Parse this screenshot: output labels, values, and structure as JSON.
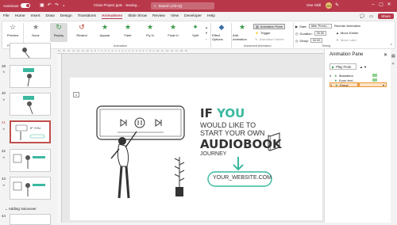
{
  "titlebar": {
    "autosave": "AutoSave",
    "file_title": "Class Project.pptx · Saving...",
    "search_placeholder": "Search (Alt+Q)",
    "user": "One Skill",
    "avatar_initials": "OS"
  },
  "tabs": [
    "File",
    "Home",
    "Insert",
    "Draw",
    "Design",
    "Transitions",
    "Animations",
    "Slide Show",
    "Review",
    "View",
    "Developer",
    "Help"
  ],
  "active_tab": "Animations",
  "share_label": "Share",
  "ribbon": {
    "preview": "Preview",
    "effects": [
      "None",
      "Replay",
      "Rewind",
      "Appear",
      "Fade",
      "Fly In",
      "Float In",
      "Split"
    ],
    "effect_options": "Effect Options",
    "add_animation": "Add Animation",
    "animation_pane": "Animation Pane",
    "trigger": "Trigger",
    "animation_painter": "Animation Painter",
    "start_label": "Start:",
    "start_value": "After Previo...",
    "duration_label": "Duration:",
    "duration_value": "00.50",
    "delay_label": "Delay:",
    "delay_value": "00.00",
    "reorder": "Reorder Animation",
    "move_earlier": "Move Earlier",
    "move_later": "Move Later",
    "groups": {
      "preview": "Preview",
      "animation": "Animation",
      "advanced": "Advanced Animation",
      "timing": "Timing"
    }
  },
  "thumbnails": [
    {
      "num": "39"
    },
    {
      "num": "40"
    },
    {
      "num": "41"
    },
    {
      "num": "42"
    },
    {
      "num": "43"
    },
    {
      "num": "44"
    }
  ],
  "section_label": "Adding Voiceover",
  "slide": {
    "line1_if": "IF ",
    "line1_you": "YOU",
    "line2": "WOULD LIKE TO",
    "line3": "START YOUR OWN",
    "line4": "AUDIOBOOK",
    "line5": "JOURNEY",
    "url": "YOUR_WEBSITE.COM"
  },
  "pane": {
    "title": "Animation Pane",
    "play_from": "Play From",
    "rows": [
      {
        "num": "0",
        "name": "Illustration"
      },
      {
        "num": "",
        "name": "If you text..."
      },
      {
        "num": "1",
        "name": "Group"
      }
    ]
  }
}
